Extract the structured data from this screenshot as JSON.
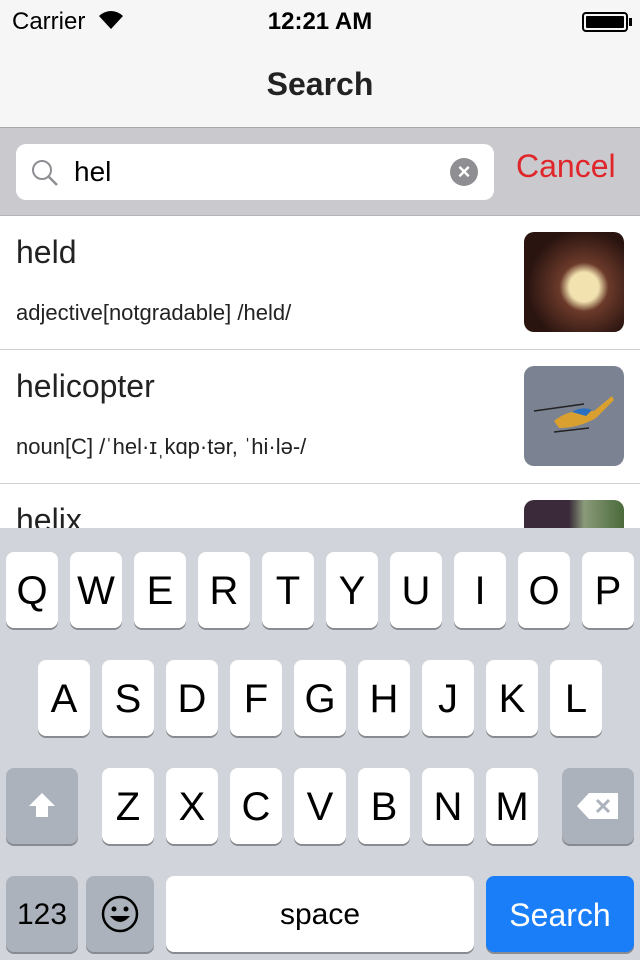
{
  "status": {
    "carrier": "Carrier",
    "time": "12:21 AM"
  },
  "nav": {
    "title": "Search"
  },
  "search": {
    "value": "hel",
    "cancel_label": "Cancel"
  },
  "results": [
    {
      "word": "held",
      "definition": "adjective[notgradable] /held/",
      "image": "chick"
    },
    {
      "word": "helicopter",
      "definition": "noun[C] /ˈhel·ɪˌkɑp·tər, ˈhi·lə-/",
      "image": "helicopter"
    },
    {
      "word": "helix",
      "definition": "",
      "image": "plant"
    }
  ],
  "keyboard": {
    "row1": [
      "Q",
      "W",
      "E",
      "R",
      "T",
      "Y",
      "U",
      "I",
      "O",
      "P"
    ],
    "row2": [
      "A",
      "S",
      "D",
      "F",
      "G",
      "H",
      "J",
      "K",
      "L"
    ],
    "row3": [
      "Z",
      "X",
      "C",
      "V",
      "B",
      "N",
      "M"
    ],
    "numbers_label": "123",
    "space_label": "space",
    "search_label": "Search"
  },
  "colors": {
    "accent": "#e0262b",
    "search_key": "#1a7ef9"
  }
}
